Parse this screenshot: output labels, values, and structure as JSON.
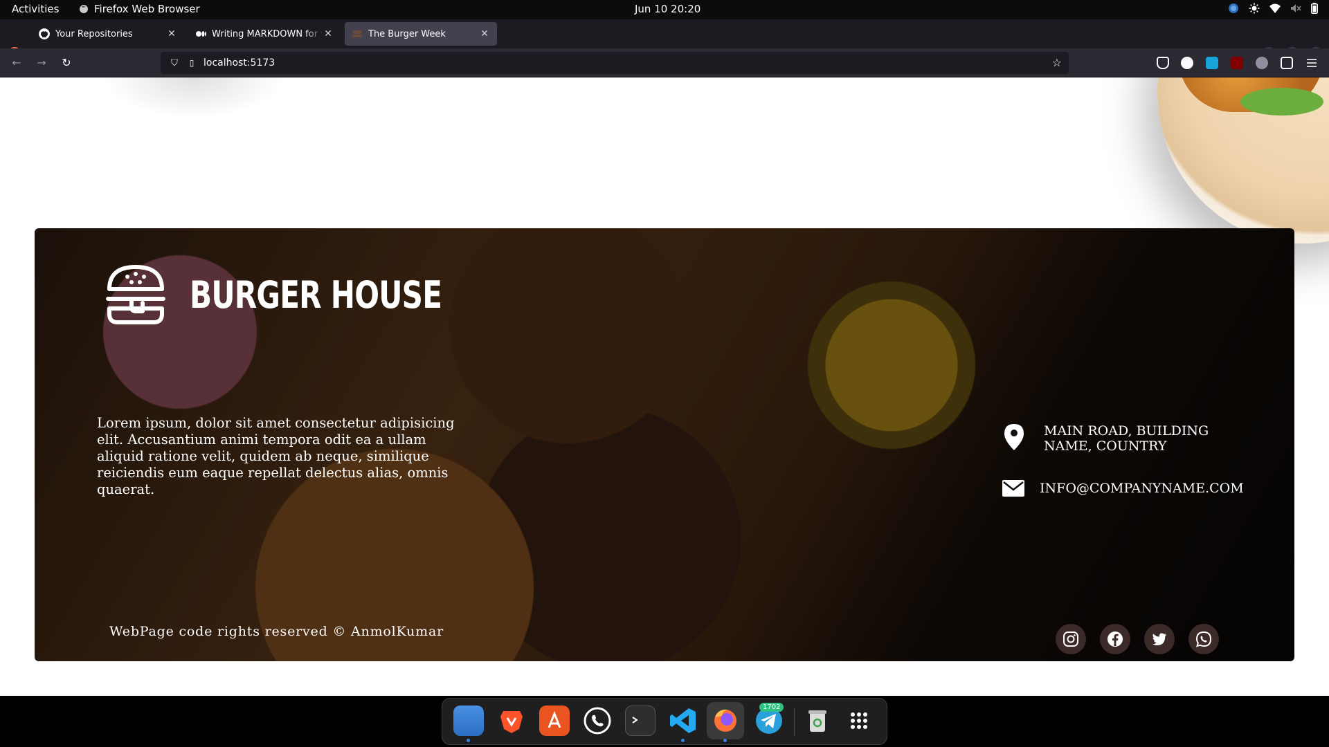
{
  "topbar": {
    "activities": "Activities",
    "app_name": "Firefox Web Browser",
    "clock": "Jun 10  20:20"
  },
  "browser": {
    "tabs": [
      {
        "title": "Your Repositories",
        "icon": "github-icon"
      },
      {
        "title": "Writing MARKDOWN for your",
        "icon": "medium-icon"
      },
      {
        "title": "The Burger Week",
        "icon": "burger-favicon"
      }
    ],
    "url": "localhost:5173",
    "accent": "#42414d"
  },
  "footer": {
    "brand_name": "BURGER HOUSE",
    "about": "Lorem ipsum, dolor sit amet consectetur adipisicing elit. Accusantium animi tempora odit ea a ullam aliquid ratione velit, quidem ab neque, similique reiciendis eum eaque repellat delectus alias, omnis quaerat.",
    "address": "MAIN ROAD, BUILDING NAME, COUNTRY",
    "email": "INFO@COMPANYNAME.COM",
    "copyright": "WebPage code rights reserved © AnmolKumar",
    "socials": [
      "instagram-icon",
      "facebook-icon",
      "twitter-icon",
      "whatsapp-icon"
    ]
  },
  "dock": {
    "telegram_badge": "1702",
    "apps": [
      "files-icon",
      "brave-icon",
      "app-store-icon",
      "whatsapp-icon",
      "terminal-icon",
      "vscode-icon",
      "firefox-icon",
      "telegram-icon",
      "trash-icon",
      "app-grid-icon"
    ]
  }
}
